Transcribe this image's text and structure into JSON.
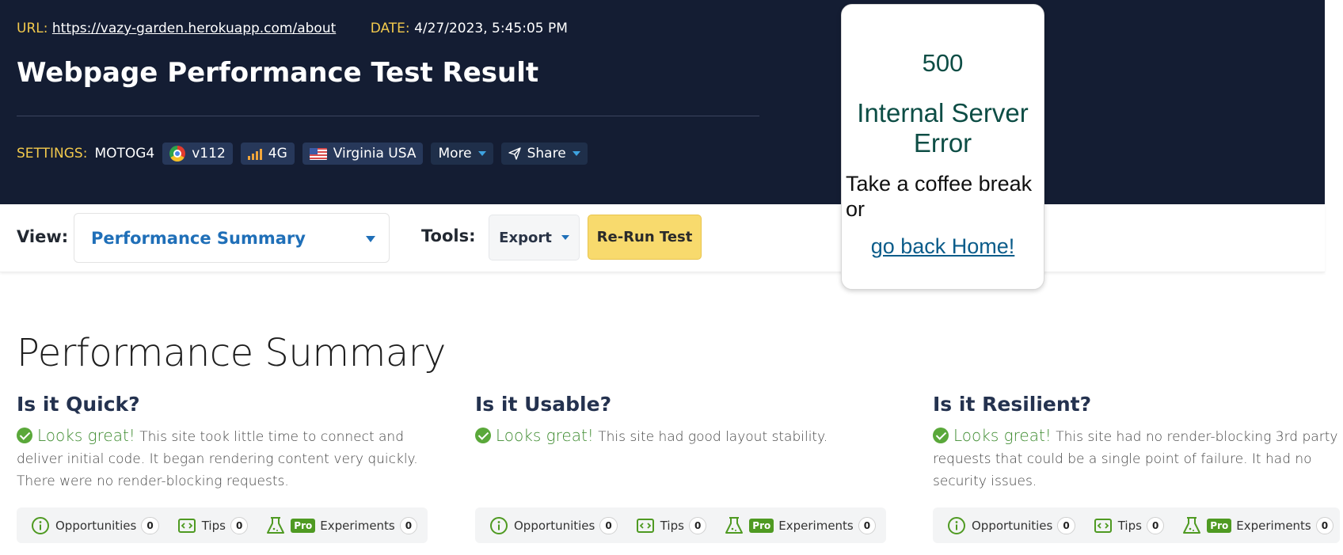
{
  "header": {
    "url_label": "URL:",
    "url": "https://vazy-garden.herokuapp.com/about",
    "date_label": "DATE:",
    "date": "4/27/2023, 5:45:05 PM",
    "title": "Webpage Performance Test Result",
    "settings_label": "SETTINGS:",
    "device": "MOTOG4",
    "browser_version": "v112",
    "connection": "4G",
    "location": "Virginia USA",
    "more_label": "More",
    "share_label": "Share"
  },
  "toolbar": {
    "view_label": "View:",
    "view_value": "Performance Summary",
    "tools_label": "Tools:",
    "export_label": "Export",
    "rerun_label": "Re-Run Test"
  },
  "popup": {
    "code": "500",
    "message": "Internal Server Error",
    "coffee": "Take a coffee break or",
    "home_link": "go back Home!"
  },
  "summary": {
    "title": "Performance Summary",
    "columns": [
      {
        "heading": "Is it Quick?",
        "status": "Looks great!",
        "text": "This site took little time to connect and deliver initial code. It began rendering content very quickly. There were no render-blocking requests."
      },
      {
        "heading": "Is it Usable?",
        "status": "Looks great!",
        "text": "This site had good layout stability."
      },
      {
        "heading": "Is it Resilient?",
        "status": "Looks great!",
        "text": "This site had no render-blocking 3rd party requests that could be a single point of failure. It had no security issues."
      }
    ],
    "stats": {
      "opportunities_label": "Opportunities",
      "tips_label": "Tips",
      "pro_label": "Pro",
      "experiments_label": "Experiments",
      "opportunities": "0",
      "tips": "0",
      "experiments": "0"
    }
  },
  "colors": {
    "header_bg": "#141d33",
    "accent_yellow": "#f2c94c",
    "link_blue": "#1f6fb8",
    "good_green": "#3d8b2f",
    "rerun_bg": "#f8da6d"
  },
  "icons": [
    "chrome-icon",
    "signal-icon",
    "us-flag-icon",
    "send-icon",
    "checkmark-icon",
    "info-icon",
    "code-icon",
    "flask-icon"
  ]
}
